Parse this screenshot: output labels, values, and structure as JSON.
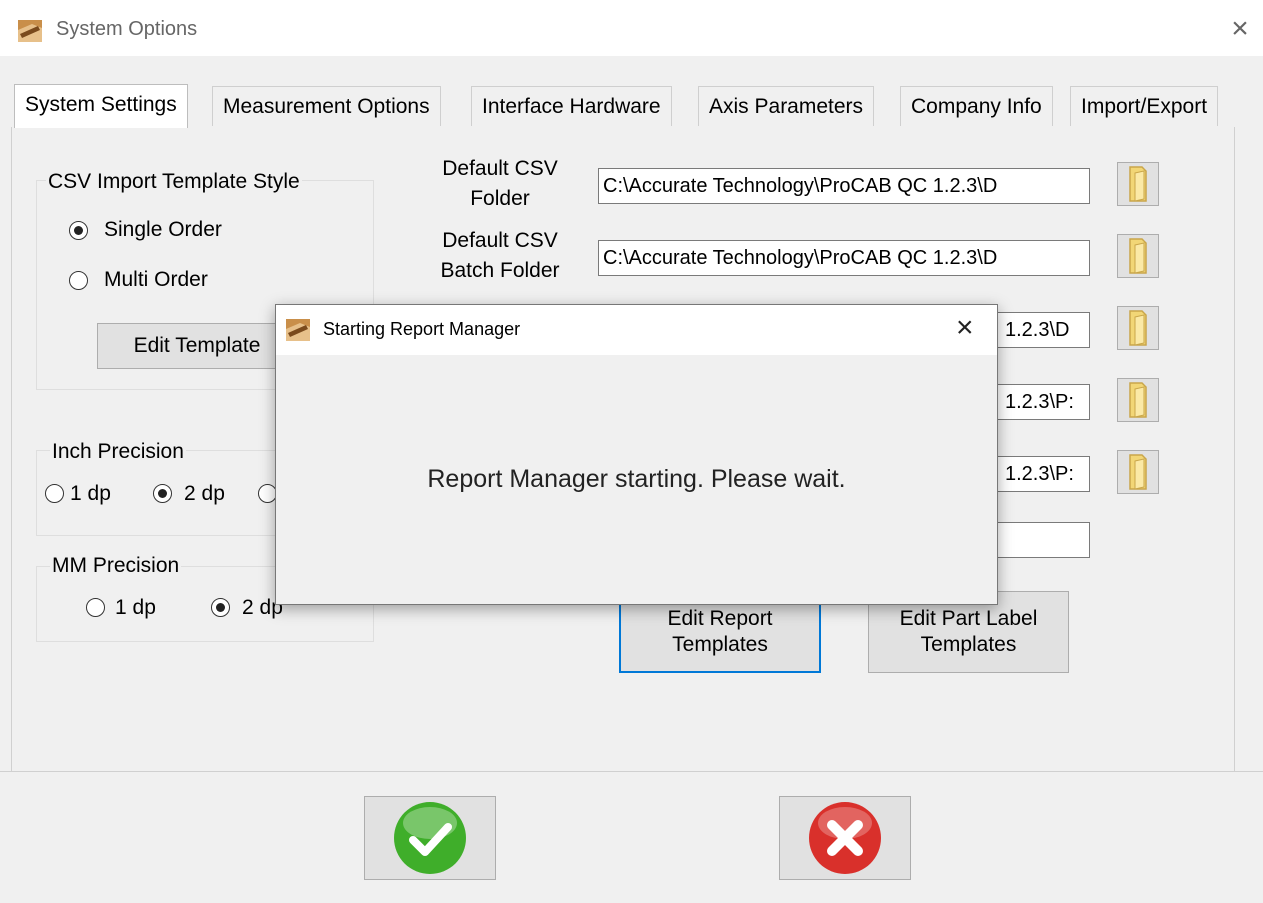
{
  "window": {
    "title": "System Options",
    "app_icon": "procab-app-icon",
    "close_icon": "close-icon"
  },
  "tabs": [
    {
      "label": "System Settings",
      "active": true
    },
    {
      "label": "Measurement Options",
      "active": false
    },
    {
      "label": "Interface Hardware",
      "active": false
    },
    {
      "label": "Axis Parameters",
      "active": false
    },
    {
      "label": "Company Info",
      "active": false
    },
    {
      "label": "Import/Export",
      "active": false
    }
  ],
  "csv_template": {
    "title": "CSV Import Template Style",
    "options": [
      {
        "label": "Single Order",
        "selected": true
      },
      {
        "label": "Multi Order",
        "selected": false
      }
    ],
    "edit_button": "Edit Template"
  },
  "inch_precision": {
    "title": "Inch Precision",
    "options": [
      {
        "label": "1 dp",
        "selected": false
      },
      {
        "label": "2 dp",
        "selected": true
      }
    ]
  },
  "mm_precision": {
    "title": "MM Precision",
    "options": [
      {
        "label": "1 dp",
        "selected": false
      },
      {
        "label": "2 dp",
        "selected": true
      }
    ]
  },
  "folders": [
    {
      "label": "Default CSV Folder",
      "value": "C:\\Accurate Technology\\ProCAB QC 1.2.3\\D"
    },
    {
      "label": "Default CSV Batch Folder",
      "value": "C:\\Accurate Technology\\ProCAB QC 1.2.3\\D"
    },
    {
      "value": "1.2.3\\D"
    },
    {
      "value": "1.2.3\\P:"
    },
    {
      "value": "1.2.3\\P:"
    }
  ],
  "buttons": {
    "edit_report_templates": "Edit Report Templates",
    "edit_part_label_templates": "Edit Part Label Templates"
  },
  "footer": {
    "ok_icon": "checkmark-icon",
    "cancel_icon": "cancel-x-icon"
  },
  "modal": {
    "title": "Starting Report Manager",
    "message": "Report Manager starting.  Please wait.",
    "close_icon": "close-icon"
  },
  "colors": {
    "focus_blue": "#0078d7",
    "ok_green": "#3fae2a",
    "cancel_red": "#d9302b"
  }
}
